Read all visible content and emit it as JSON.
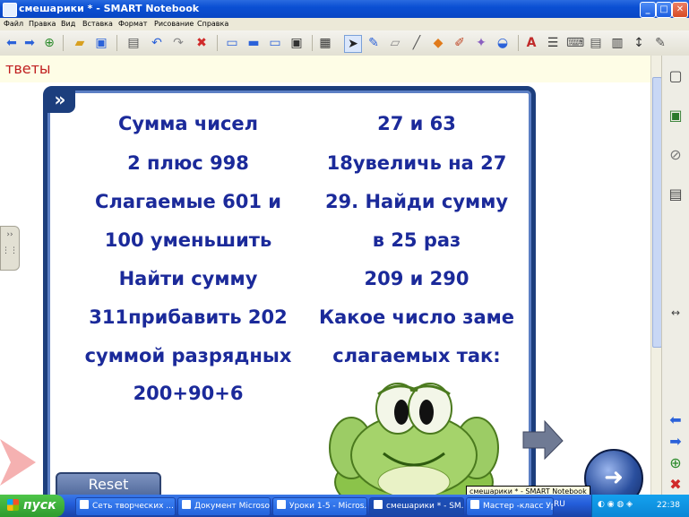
{
  "window": {
    "title": "смешарики * - SMART Notebook"
  },
  "menu": [
    "Файл",
    "Правка",
    "Вид",
    "Вставка",
    "Формат",
    "Рисование",
    "Справка"
  ],
  "page": {
    "title": "тветы"
  },
  "card": {
    "left_rows": [
      "Сумма чисел",
      "2 плюс 998",
      "Слагаемые 601 и",
      "100 уменьшить",
      "Найти сумму",
      "311прибавить 202",
      "суммой разрядных",
      "200+90+6"
    ],
    "right_rows": [
      "27 и   63",
      "18увеличь на 27",
      "29. Найди сумму",
      "в 25 раз",
      "209 и 290",
      "Какое число заме",
      "слагаемых так:"
    ]
  },
  "reset_label": "Reset",
  "tooltip": "смешарики * - SMART Notebook",
  "taskbar": {
    "start": "пуск",
    "tasks": [
      "Сеть творческих ...",
      "Документ Microsof...",
      "Уроки 1-5 - Micros...",
      "смешарики * - SM...",
      "Мастер -класс Ура..."
    ],
    "lang": "RU",
    "clock": "22:38"
  }
}
